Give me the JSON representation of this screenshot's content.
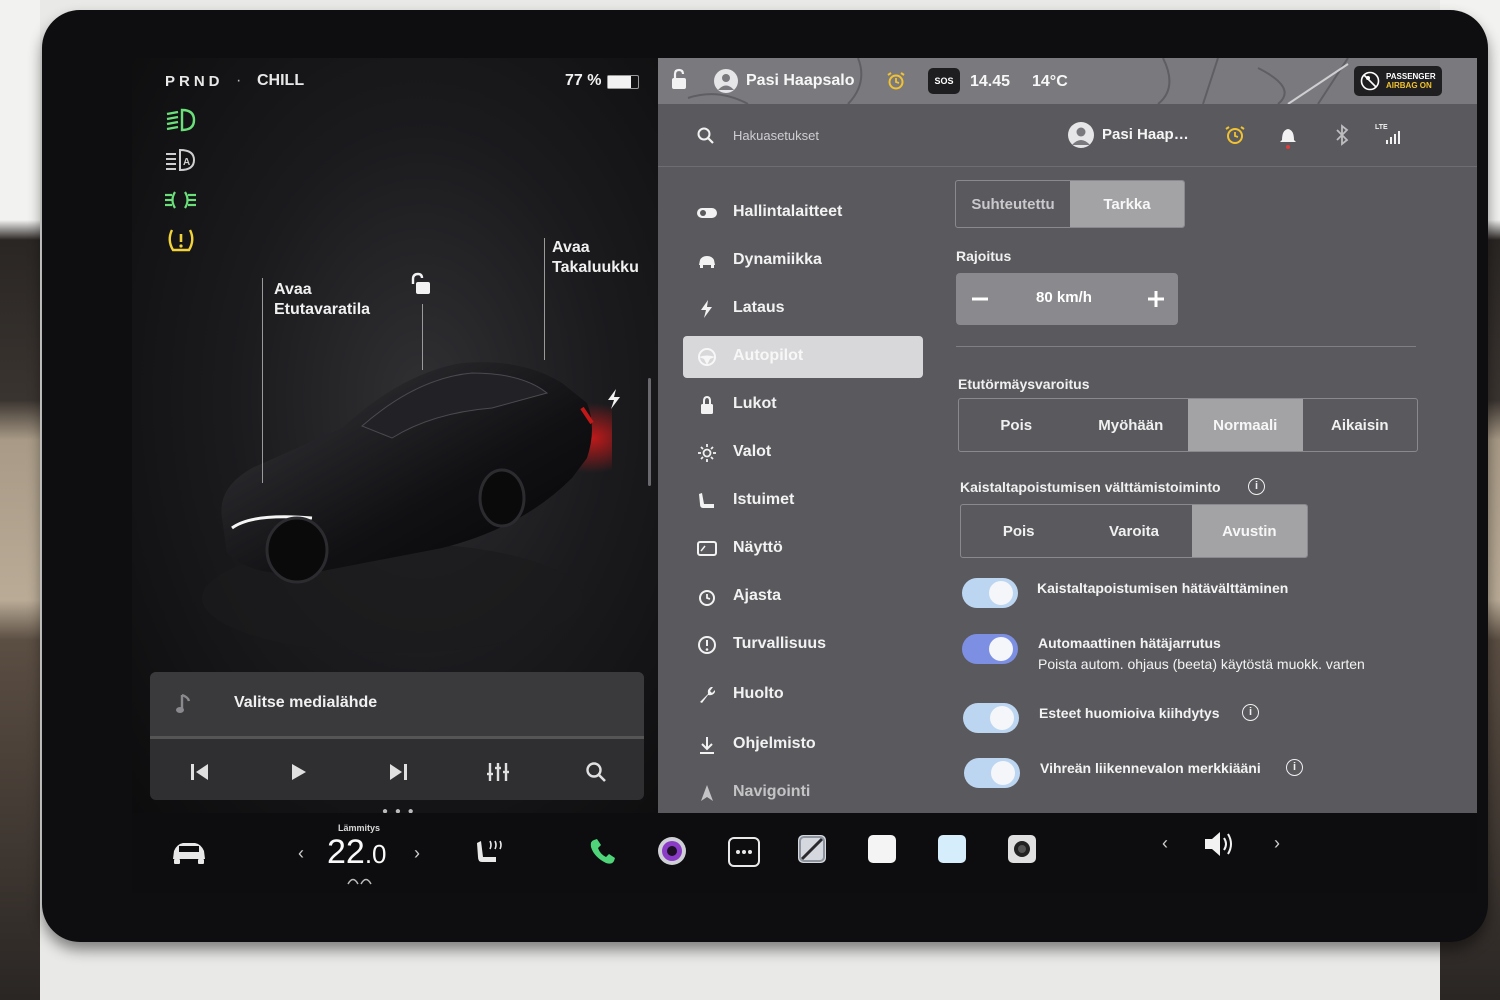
{
  "status_bar": {
    "gear": "PRND",
    "separator": "·",
    "drive_mode": "CHILL",
    "battery_percent": "77 %",
    "battery_level": 0.77,
    "user_name": "Pasi Haapsalo",
    "sos_label": "SOS",
    "time": "14.45",
    "temperature": "14°C",
    "airbag_line1": "PASSENGER",
    "airbag_line2": "AIRBAG ON"
  },
  "car_view": {
    "frunk_line1": "Avaa",
    "frunk_line2": "Etutavaratila",
    "trunk_line1": "Avaa",
    "trunk_line2": "Takaluukku"
  },
  "media": {
    "source_label": "Valitse medialähde",
    "controls": [
      "previous-track",
      "play",
      "next-track",
      "equalizer",
      "search"
    ]
  },
  "settings_header": {
    "search_placeholder": "Hakuasetukset",
    "user_short": "Pasi Haap…",
    "signal_label": "LTE"
  },
  "nav": {
    "items": [
      {
        "label": "Hallintalaitteet",
        "icon": "toggle-icon"
      },
      {
        "label": "Dynamiikka",
        "icon": "car-icon"
      },
      {
        "label": "Lataus",
        "icon": "bolt-icon"
      },
      {
        "label": "Autopilot",
        "icon": "steering-wheel-icon",
        "active": true
      },
      {
        "label": "Lukot",
        "icon": "lock-icon"
      },
      {
        "label": "Valot",
        "icon": "sun-icon"
      },
      {
        "label": "Istuimet",
        "icon": "seat-icon"
      },
      {
        "label": "Näyttö",
        "icon": "display-icon"
      },
      {
        "label": "Ajasta",
        "icon": "alarm-clock-icon"
      },
      {
        "label": "Turvallisuus",
        "icon": "info-circle-icon"
      },
      {
        "label": "Huolto",
        "icon": "wrench-icon"
      },
      {
        "label": "Ohjelmisto",
        "icon": "download-icon"
      },
      {
        "label": "Navigointi",
        "icon": "navigation-arrow-icon"
      }
    ]
  },
  "autopilot": {
    "speed_mode_options": [
      "Suhteutettu",
      "Tarkka"
    ],
    "speed_mode_selected": "Tarkka",
    "limit_label": "Rajoitus",
    "limit_value": "80 km/h",
    "fcw_label": "Etutörmäysvaroitus",
    "fcw_options": [
      "Pois",
      "Myöhään",
      "Normaali",
      "Aikaisin"
    ],
    "fcw_selected": "Normaali",
    "lda_label": "Kaistaltapoistumisen välttämistoiminto",
    "lda_options": [
      "Pois",
      "Varoita",
      "Avustin"
    ],
    "lda_selected": "Avustin",
    "toggles": [
      {
        "label": "Kaistaltapoistumisen hätävälttäminen",
        "on": true,
        "sub": "",
        "info": false
      },
      {
        "label": "Automaattinen hätäjarrutus",
        "on": true,
        "sub": "Poista autom. ohjaus (beeta) käytöstä muokk. varten",
        "info": false
      },
      {
        "label": "Esteet huomioiva kiihdytys",
        "on": true,
        "sub": "",
        "info": true
      },
      {
        "label": "Vihreän liikennevalon merkkiääni",
        "on": true,
        "sub": "",
        "info": true
      }
    ]
  },
  "dock": {
    "heating_label": "Lämmitys",
    "temperature_int": "22",
    "temperature_dec": ".0",
    "apps": [
      "phone-icon",
      "camera-lens-icon",
      "more-apps-icon",
      "dashcam-icon",
      "calendar-icon",
      "toybox-icon",
      "camera-icon"
    ]
  },
  "colors": {
    "settings_bg": "#5a5a5e",
    "toggle_on": "#bcd6f2",
    "toggle_accent": "#7d8fe3",
    "green_tell_tale": "#6be07a",
    "yellow_warning": "#f2d33a"
  }
}
